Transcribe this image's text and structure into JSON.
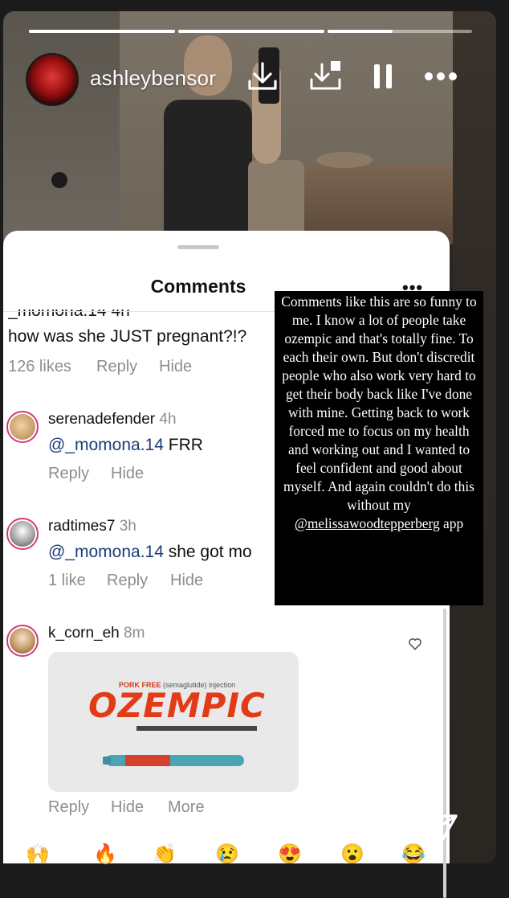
{
  "story": {
    "username": "ashleybensor",
    "progress": [
      1,
      1,
      0.45
    ]
  },
  "comments_sheet": {
    "title": "Comments",
    "menu_glyph": "•••",
    "cut_off_name": "_momona.14 4h",
    "first_comment": {
      "text": "how was she JUST pregnant?!?",
      "likes": "126 likes",
      "reply": "Reply",
      "hide": "Hide"
    },
    "comments": [
      {
        "user": "serenadefender",
        "time": "4h",
        "mention": "@_momona.14",
        "text": " FRR",
        "reply": "Reply",
        "hide": "Hide",
        "avatar_color": "#c9a068"
      },
      {
        "user": "radtimes7",
        "time": "3h",
        "mention": "@_momona.14",
        "text": " she got mo",
        "likes": "1 like",
        "reply": "Reply",
        "hide": "Hide",
        "avatar_color": "#d8d0c8"
      },
      {
        "user": "k_corn_eh",
        "time": "8m",
        "reply": "Reply",
        "hide": "Hide",
        "more": "More",
        "avatar_color": "#b8956a"
      }
    ],
    "ozempic_image": {
      "subtitle_brand": "PORK FREE",
      "subtitle_rest": "(semaglutide) injection",
      "logo": "OZEMPIC"
    }
  },
  "overlay_text": {
    "body": "Comments like this are so funny to me. I know a lot of people take ozempic and that's totally fine. To each their own. But don't discredit people who also work very hard to get their body back like I've done with mine. Getting back to work forced me to focus on my health and working out and I wanted to feel confident and good about myself. And again couldn't do this without my",
    "mention": "@melissawoodtepperberg",
    "tail": "app"
  },
  "reactions": [
    "🙌",
    "🔥",
    "👏",
    "😢",
    "😍",
    "😮",
    "😂"
  ],
  "icons": [
    "download-icon",
    "add-to-story-icon",
    "pause-icon",
    "more-icon",
    "heart-icon",
    "send-icon"
  ],
  "colors": {
    "mention": "#1a3d7a",
    "avatar_ring": "#d23b7a",
    "ozempic_red": "#e23b18"
  }
}
